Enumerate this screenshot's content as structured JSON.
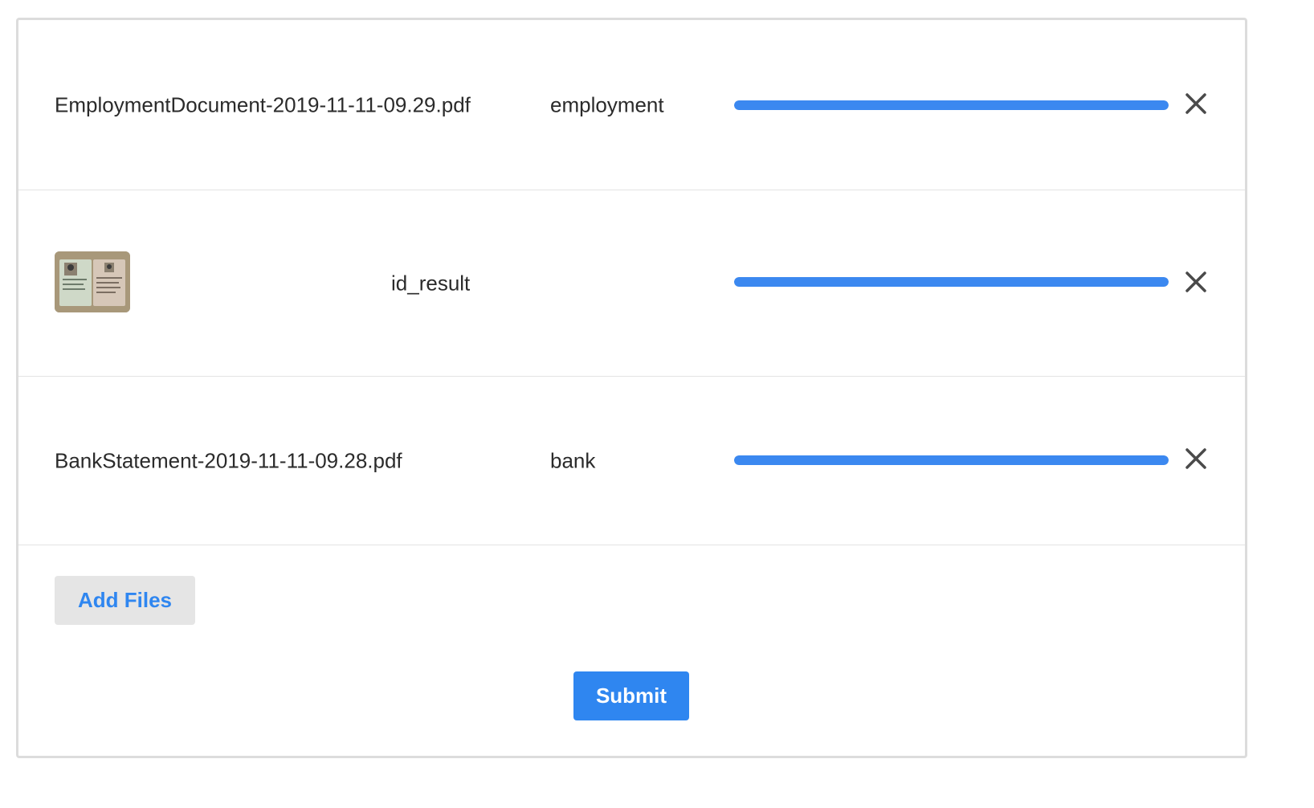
{
  "files": [
    {
      "name": "EmploymentDocument-2019-11-11-09.29.pdf",
      "category": "employment",
      "progress": 1.0,
      "icon": "close-icon"
    },
    {
      "name": "",
      "thumbnail": "id-card-thumbnail",
      "category": "id_result",
      "progress": 1.0,
      "icon": "close-icon"
    },
    {
      "name": "BankStatement-2019-11-11-09.28.pdf",
      "category": "bank",
      "progress": 1.0,
      "icon": "close-icon"
    }
  ],
  "actions": {
    "add_files_label": "Add Files",
    "submit_label": "Submit"
  },
  "colors": {
    "accent": "#2f86f0",
    "progress": "#3b88f0",
    "secondary_button": "#e5e5e5"
  }
}
